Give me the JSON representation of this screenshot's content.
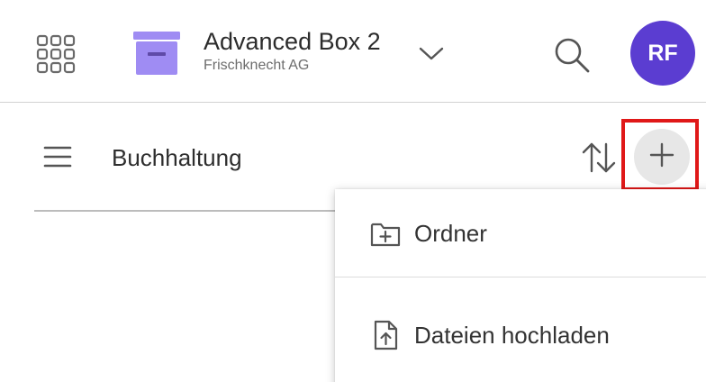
{
  "header": {
    "app_title": "Advanced Box 2",
    "app_subtitle": "Frischknecht AG",
    "avatar_initials": "RF",
    "avatar_color": "#5b3dd1",
    "box_icon_color": "#9f8cf3",
    "icons": {
      "apps": "apps-grid-icon",
      "box": "archive-box-icon",
      "chevron": "chevron-down-icon",
      "search": "search-icon"
    }
  },
  "toolbar": {
    "folder_title": "Buchhaltung",
    "icons": {
      "menu": "hamburger-menu-icon",
      "sort": "sort-icon",
      "add": "plus-icon"
    },
    "highlight_color": "#e01818"
  },
  "dropdown": {
    "items": [
      {
        "label": "Ordner",
        "icon": "new-folder-icon"
      },
      {
        "label": "Dateien hochladen",
        "icon": "file-upload-icon"
      }
    ]
  }
}
